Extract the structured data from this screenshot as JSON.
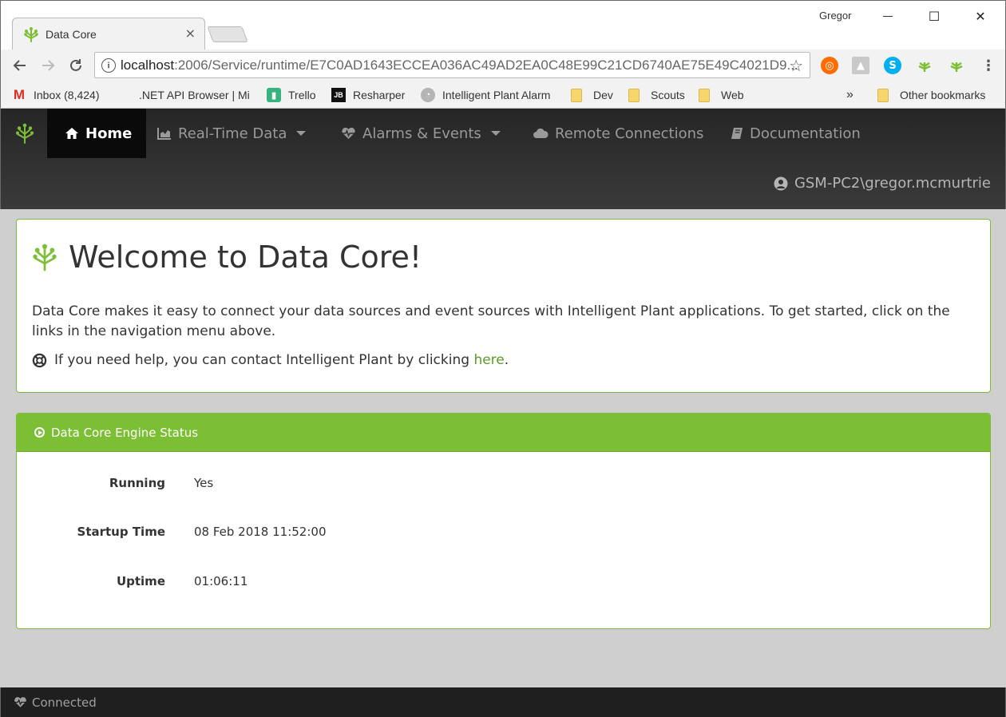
{
  "browser": {
    "tab_title": "Data Core",
    "tab_close": "×",
    "profile_name": "Gregor",
    "window_controls": {
      "minimize": "—",
      "maximize": "☐",
      "close": "✕"
    },
    "url_host": "localhost",
    "url_path": ":2006/Service/runtime/E7C0AD1643ECCEA036AC49AD2EA0C48E99C21CD6740AE75E49C4021D9...",
    "bookmarks": [
      {
        "label": "Inbox (8,424)",
        "icon": "gmail-icon"
      },
      {
        "label": ".NET API Browser | Mi",
        "icon": "microsoft-icon"
      },
      {
        "label": "Trello",
        "icon": "trello-icon"
      },
      {
        "label": "Resharper",
        "icon": "jetbrains-icon"
      },
      {
        "label": "Intelligent Plant Alarm",
        "icon": "plant-alarm-icon"
      },
      {
        "label": "Dev",
        "icon": "folder-icon"
      },
      {
        "label": "Scouts",
        "icon": "folder-icon"
      },
      {
        "label": "Web",
        "icon": "folder-icon"
      }
    ],
    "overflow": "»",
    "other_bookmarks": "Other bookmarks",
    "colors": {
      "gmail": "#d93025",
      "trello": "#36b37e",
      "skype": "#00aff0",
      "ext_orange": "#ff6d00"
    }
  },
  "nav": {
    "items": [
      {
        "label": "Home",
        "icon": "home-icon",
        "active": true
      },
      {
        "label": "Real-Time Data",
        "icon": "chart-icon",
        "dropdown": true
      },
      {
        "label": "Alarms & Events",
        "icon": "heartbeat-icon",
        "dropdown": true
      },
      {
        "label": "Remote Connections",
        "icon": "cloud-icon"
      },
      {
        "label": "Documentation",
        "icon": "book-icon"
      }
    ],
    "user": "GSM-PC2\\gregor.mcmurtrie"
  },
  "welcome": {
    "title": "Welcome to Data Core!",
    "intro": "Data Core makes it easy to connect your data sources and event sources with Intelligent Plant applications. To get started, click on the links in the navigation menu above.",
    "help_prefix": "If you need help, you can contact Intelligent Plant by clicking ",
    "help_link": "here",
    "help_suffix": "."
  },
  "status": {
    "title": "Data Core Engine Status",
    "rows": [
      {
        "label": "Running",
        "value": "Yes"
      },
      {
        "label": "Startup Time",
        "value": "08 Feb 2018 11:52:00"
      },
      {
        "label": "Uptime",
        "value": "01:06:11"
      }
    ]
  },
  "footer": {
    "status": "Connected"
  },
  "theme": {
    "accent": "#7dbf34",
    "link": "#5b9c25",
    "nav_bg": "#2b2b2b"
  }
}
